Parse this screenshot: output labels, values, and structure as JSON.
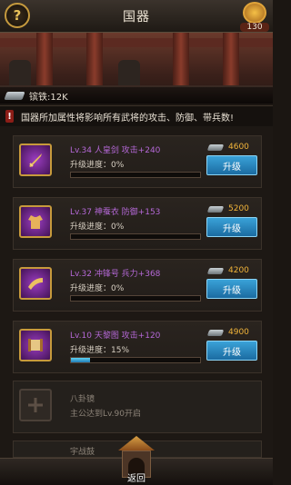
{
  "header": {
    "title": "国器"
  },
  "currency": {
    "count": "130",
    "icon": "gold-coin-icon"
  },
  "resource": {
    "iron_label": "镔铁:12K"
  },
  "notice": {
    "mark": "!",
    "text": "国器所加属性将影响所有武将的攻击、防御、带兵数!"
  },
  "items": [
    {
      "name": "Lv.34 人皇剑 攻击+240",
      "progress_label": "升级进度：0%",
      "progress": 0,
      "cost": "4600",
      "button": "升级",
      "icon": "sword-icon"
    },
    {
      "name": "Lv.37 神蚕衣 防御+153",
      "progress_label": "升级进度：0%",
      "progress": 0,
      "cost": "5200",
      "button": "升级",
      "icon": "armor-icon"
    },
    {
      "name": "Lv.32 冲锋号 兵力+368",
      "progress_label": "升级进度：0%",
      "progress": 0,
      "cost": "4200",
      "button": "升级",
      "icon": "horn-icon"
    },
    {
      "name": "Lv.10 天黎图 攻击+120",
      "progress_label": "升级进度：15%",
      "progress": 15,
      "cost": "4900",
      "button": "升级",
      "icon": "scroll-icon"
    }
  ],
  "locked_items": [
    {
      "name": "八卦镜",
      "requirement": "主公达到Lv.90开启",
      "icon": "lock-icon"
    },
    {
      "name": "宇战鼓",
      "requirement": "",
      "icon": "lock-icon"
    }
  ],
  "bottom": {
    "back_label": "返回"
  },
  "colors": {
    "accent_blue": "#2a8bc7",
    "item_name_purple": "#b468d6",
    "cost_gold": "#f1b43a"
  }
}
